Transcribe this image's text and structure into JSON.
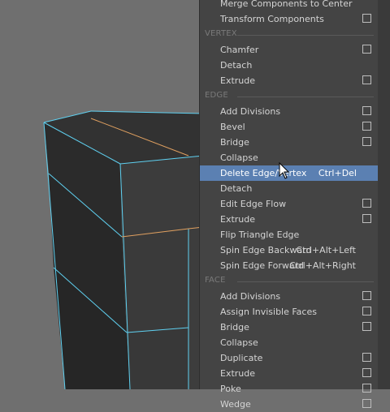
{
  "viewport": {
    "bg_color": "#6f6f6f",
    "edge_highlight_color": "#5fd0f0",
    "edge_loop_color": "#e0a060"
  },
  "menu": {
    "highlight_color": "#5b80b2",
    "items": [
      {
        "kind": "item",
        "label": "Merge Components to Center",
        "option_box": false
      },
      {
        "kind": "item",
        "label": "Transform Components",
        "option_box": true
      },
      {
        "kind": "header",
        "label": "VERTEX"
      },
      {
        "kind": "item",
        "label": "Chamfer",
        "option_box": true
      },
      {
        "kind": "item",
        "label": "Detach",
        "option_box": false
      },
      {
        "kind": "item",
        "label": "Extrude",
        "option_box": true
      },
      {
        "kind": "header",
        "label": "EDGE"
      },
      {
        "kind": "item",
        "label": "Add Divisions",
        "option_box": true
      },
      {
        "kind": "item",
        "label": "Bevel",
        "option_box": true
      },
      {
        "kind": "item",
        "label": "Bridge",
        "option_box": true
      },
      {
        "kind": "item",
        "label": "Collapse",
        "option_box": false
      },
      {
        "kind": "item",
        "label": "Delete Edge/Vertex",
        "shortcut": "Ctrl+Del",
        "option_box": false,
        "highlighted": true
      },
      {
        "kind": "item",
        "label": "Detach",
        "option_box": false
      },
      {
        "kind": "item",
        "label": "Edit Edge Flow",
        "option_box": true
      },
      {
        "kind": "item",
        "label": "Extrude",
        "option_box": true
      },
      {
        "kind": "item",
        "label": "Flip Triangle Edge",
        "option_box": false
      },
      {
        "kind": "item",
        "label": "Spin Edge Backward",
        "shortcut": "Ctrl+Alt+Left",
        "option_box": false
      },
      {
        "kind": "item",
        "label": "Spin Edge Forward",
        "shortcut": "Ctrl+Alt+Right",
        "option_box": false
      },
      {
        "kind": "header",
        "label": "FACE"
      },
      {
        "kind": "item",
        "label": "Add Divisions",
        "option_box": true
      },
      {
        "kind": "item",
        "label": "Assign Invisible Faces",
        "option_box": true
      },
      {
        "kind": "item",
        "label": "Bridge",
        "option_box": true
      },
      {
        "kind": "item",
        "label": "Collapse",
        "option_box": false
      },
      {
        "kind": "item",
        "label": "Duplicate",
        "option_box": true
      },
      {
        "kind": "item",
        "label": "Extrude",
        "option_box": true
      },
      {
        "kind": "item",
        "label": "Poke",
        "option_box": true
      },
      {
        "kind": "item",
        "label": "Wedge",
        "option_box": true
      }
    ]
  }
}
